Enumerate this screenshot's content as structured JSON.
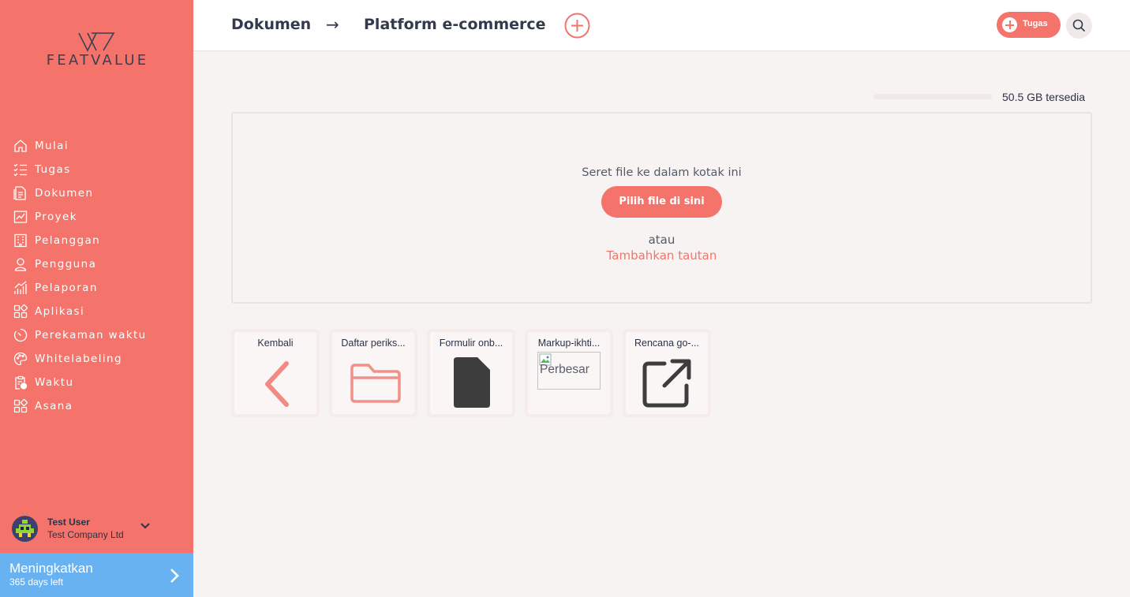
{
  "app": {
    "brand": "FEATVALUE",
    "accent_color": "#f4736a",
    "upgrade_color": "#69b2f2"
  },
  "sidebar": {
    "items": [
      {
        "label": "Mulai",
        "icon": "home-icon"
      },
      {
        "label": "Tugas",
        "icon": "checklist-icon"
      },
      {
        "label": "Dokumen",
        "icon": "document-icon"
      },
      {
        "label": "Proyek",
        "icon": "chart-icon"
      },
      {
        "label": "Pelanggan",
        "icon": "building-icon"
      },
      {
        "label": "Pengguna",
        "icon": "user-icon"
      },
      {
        "label": "Pelaporan",
        "icon": "bar-chart-icon"
      },
      {
        "label": "Aplikasi",
        "icon": "apps-icon"
      },
      {
        "label": "Perekaman waktu",
        "icon": "timer-icon"
      },
      {
        "label": "Whitelabeling",
        "icon": "palette-icon"
      },
      {
        "label": "Waktu",
        "icon": "clipboard-clock-icon"
      },
      {
        "label": "Asana",
        "icon": "apps-icon"
      }
    ],
    "user": {
      "name": "Test User",
      "company": "Test Company Ltd"
    },
    "upgrade": {
      "title": "Meningkatkan",
      "subtitle": "365 days left"
    }
  },
  "header": {
    "breadcrumb": [
      "Dokumen",
      "Platform e-commerce"
    ],
    "breadcrumb_separator": "→",
    "tugas_label": "Tugas"
  },
  "storage": {
    "text": "50.5 GB tersedia",
    "used_fraction": 0.0
  },
  "dropzone": {
    "hint": "Seret file ke dalam kotak ini",
    "button": "Pilih file di sini",
    "or": "atau",
    "link": "Tambahkan tautan"
  },
  "files": [
    {
      "name": "Kembali",
      "icon": "chevron-left-icon"
    },
    {
      "name": "Daftar periks...",
      "icon": "folder-icon"
    },
    {
      "name": "Formulir onb...",
      "icon": "file-icon"
    },
    {
      "name": "Markup-ikhti...",
      "icon": "broken-image-icon",
      "alt": "Perbesar"
    },
    {
      "name": "Rencana go-...",
      "icon": "external-link-icon"
    }
  ]
}
